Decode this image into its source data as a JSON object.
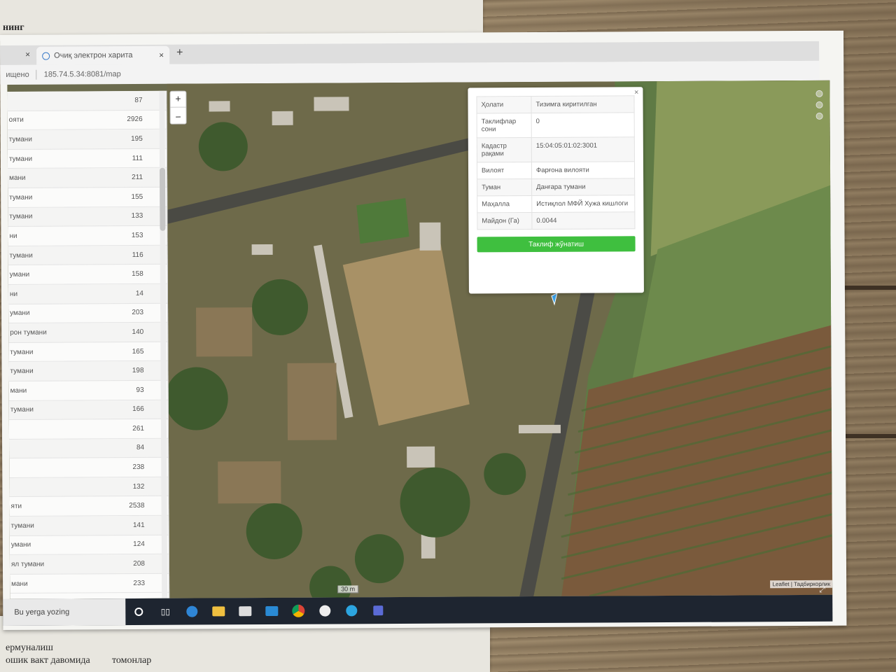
{
  "browser": {
    "tab_title": "Очиқ электрон харита",
    "address": "185.74.5.34:8081/map",
    "address_prefix": "ищено",
    "new_tab": "+",
    "tab_close": "×"
  },
  "map": {
    "zoom_in": "+",
    "zoom_out": "−",
    "scale_label": "30 m",
    "attribution": "Leaflet | Тадбиркорлик",
    "fullscreen": "⤢"
  },
  "sidebar": {
    "rows": [
      {
        "name": "",
        "value": "87"
      },
      {
        "name": "ояти",
        "value": "2926"
      },
      {
        "name": "тумани",
        "value": "195"
      },
      {
        "name": "тумани",
        "value": "111"
      },
      {
        "name": "мани",
        "value": "211"
      },
      {
        "name": "тумани",
        "value": "155"
      },
      {
        "name": "тумани",
        "value": "133"
      },
      {
        "name": "ни",
        "value": "153"
      },
      {
        "name": "тумани",
        "value": "116"
      },
      {
        "name": "умани",
        "value": "158"
      },
      {
        "name": "ни",
        "value": "14"
      },
      {
        "name": "умани",
        "value": "203"
      },
      {
        "name": "рон тумани",
        "value": "140"
      },
      {
        "name": "тумани",
        "value": "165"
      },
      {
        "name": "тумани",
        "value": "198"
      },
      {
        "name": "мани",
        "value": "93"
      },
      {
        "name": "тумани",
        "value": "166"
      },
      {
        "name": "",
        "value": "261"
      },
      {
        "name": "",
        "value": "84"
      },
      {
        "name": "",
        "value": "238"
      },
      {
        "name": "",
        "value": "132"
      },
      {
        "name": "яти",
        "value": "2538"
      },
      {
        "name": "тумани",
        "value": "141"
      },
      {
        "name": "умани",
        "value": "124"
      },
      {
        "name": "ял тумани",
        "value": "208"
      },
      {
        "name": "мани",
        "value": "233"
      }
    ]
  },
  "popup": {
    "close": "×",
    "rows": [
      {
        "key": "Ҳолати",
        "value": "Тизимга киритилган"
      },
      {
        "key": "Таклифлар сони",
        "value": "0"
      },
      {
        "key": "Кадастр рақами",
        "value": "15:04:05:01:02:3001"
      },
      {
        "key": "Вилоят",
        "value": "Фарғона вилояти"
      },
      {
        "key": "Туман",
        "value": "Данғара тумани"
      },
      {
        "key": "Маҳалла",
        "value": "Истиқлол МФЙ Хужа кишлоги"
      },
      {
        "key": "Майдон (Га)",
        "value": "0.0044"
      }
    ],
    "button": "Таклиф жўнатиш"
  },
  "taskbar": {
    "search_placeholder": "Bu yerga yozing"
  },
  "background_paper": {
    "top_text": "нинг",
    "bottom_text_1": "ермуналиш",
    "bottom_text_2": "ошик вакт давомида",
    "bottom_text_3": "томонлар"
  },
  "colors": {
    "button_green": "#3fbf3f",
    "taskbar": "#1e2530"
  }
}
